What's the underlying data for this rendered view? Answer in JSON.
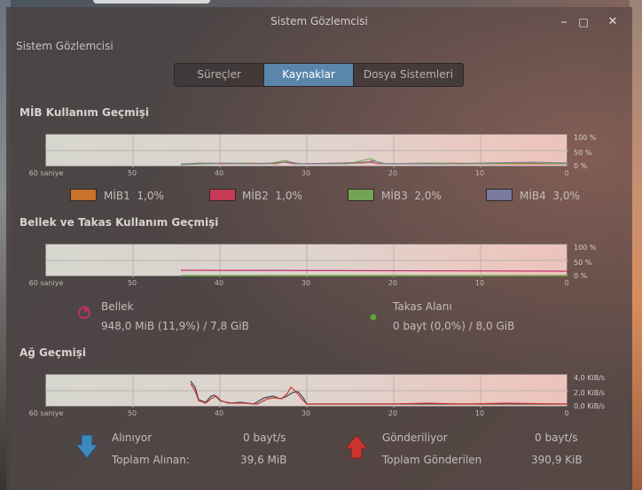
{
  "window": {
    "title": "Sistem Gözlemcisi",
    "app_label": "Sistem Gözlemcisi",
    "minimize": "–",
    "maximize": "□",
    "close": "✕"
  },
  "tabs": [
    {
      "label": "Süreçler",
      "active": false
    },
    {
      "label": "Kaynaklar",
      "active": true
    },
    {
      "label": "Dosya Sistemleri",
      "active": false
    }
  ],
  "axis_labels": [
    "60 saniye",
    "50",
    "40",
    "30",
    "20",
    "10",
    "0"
  ],
  "cpu": {
    "title": "MİB Kullanım Geçmişi",
    "pct_labels": [
      "100 %",
      "50 %",
      "0 %"
    ],
    "legend": [
      {
        "name": "MİB1",
        "value": "1,0%",
        "color": "#c9702a"
      },
      {
        "name": "MİB2",
        "value": "1,0%",
        "color": "#c73a55"
      },
      {
        "name": "MİB3",
        "value": "2,0%",
        "color": "#74a356"
      },
      {
        "name": "MİB4",
        "value": "3,0%",
        "color": "#7a79a0"
      }
    ]
  },
  "memory": {
    "title": "Bellek ve Takas Kullanım Geçmişi",
    "pct_labels": [
      "100 %",
      "50 %",
      "0 %"
    ],
    "ram_label": "Bellek",
    "ram_value": "948,0 MiB (11,9%) / 7,8 GiB",
    "ram_icon": "pie-chart-icon",
    "ram_color": "#c0306a",
    "swap_label": "Takas Alanı",
    "swap_value": "0 bayt (0,0%) / 8,0 GiB",
    "swap_icon": "dot-icon",
    "swap_color": "#5fa33c"
  },
  "network": {
    "title": "Ağ Geçmişi",
    "scale_labels": [
      "4,0 KiB/s",
      "2,0 KiB/s",
      "0,0 KiB/s"
    ],
    "receiving_label": "Alınıyor",
    "receiving_value": "0 bayt/s",
    "total_received_label": "Toplam Alınan:",
    "total_received_value": "39,6 MiB",
    "sending_label": "Gönderiliyor",
    "sending_value": "0 bayt/s",
    "total_sent_label": "Toplam Gönderilen",
    "total_sent_value": "390,9 KiB",
    "download_icon": "arrow-down-icon",
    "download_color": "#3d88c0",
    "upload_icon": "arrow-up-icon",
    "upload_color": "#c8362e"
  }
}
